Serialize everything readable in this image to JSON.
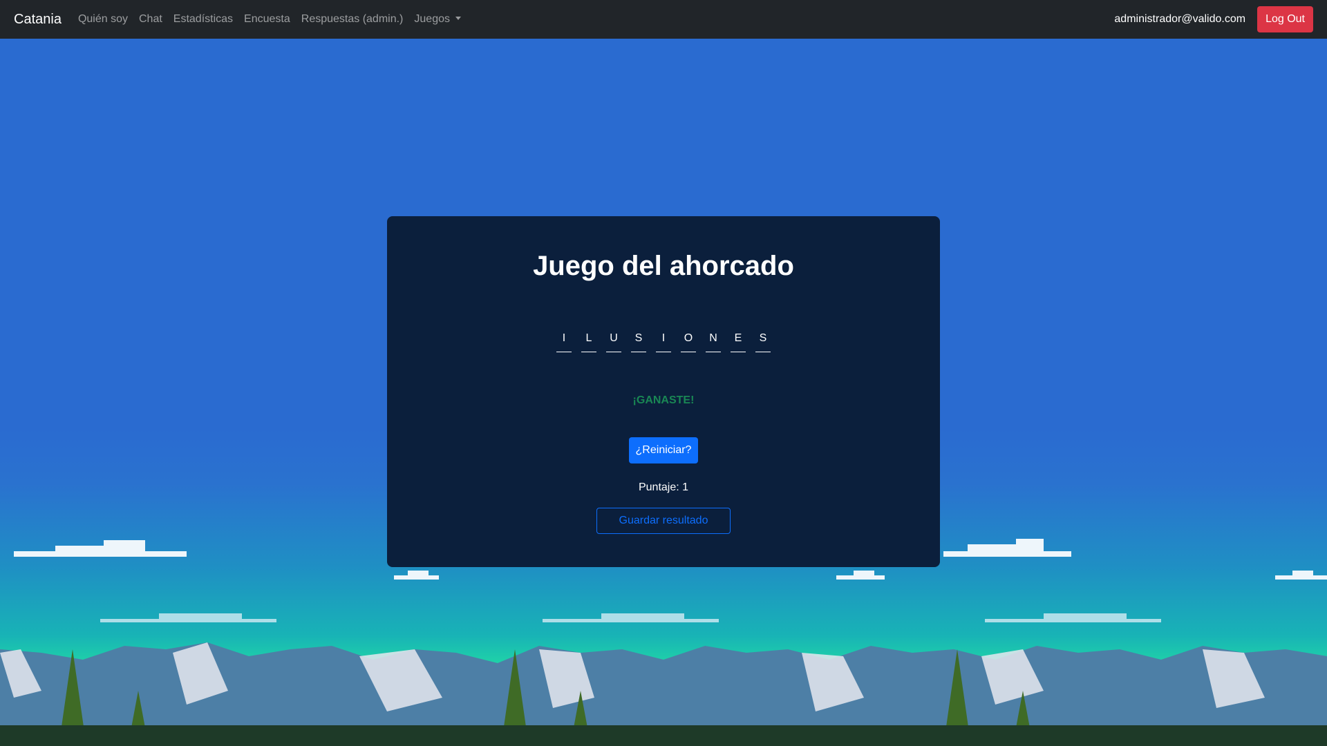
{
  "navbar": {
    "brand": "Catania",
    "links": [
      {
        "label": "Quién soy"
      },
      {
        "label": "Chat"
      },
      {
        "label": "Estadísticas"
      },
      {
        "label": "Encuesta"
      },
      {
        "label": "Respuestas (admin.)"
      },
      {
        "label": "Juegos"
      }
    ],
    "user_email": "administrador@valido.com",
    "logout_label": "Log Out"
  },
  "game": {
    "title": "Juego del ahorcado",
    "letters": [
      "I",
      "L",
      "U",
      "S",
      "I",
      "O",
      "N",
      "E",
      "S"
    ],
    "result": "¡GANASTE!",
    "restart_label": "¿Reiniciar?",
    "score_text": "Puntaje: 1",
    "save_label": "Guardar resultado"
  },
  "colors": {
    "navbar_bg": "#212529",
    "sky": "#2a6bd0",
    "card_bg": "#0b1f3c",
    "win_text": "#198754",
    "primary": "#0d6efd",
    "danger": "#dc3545"
  }
}
